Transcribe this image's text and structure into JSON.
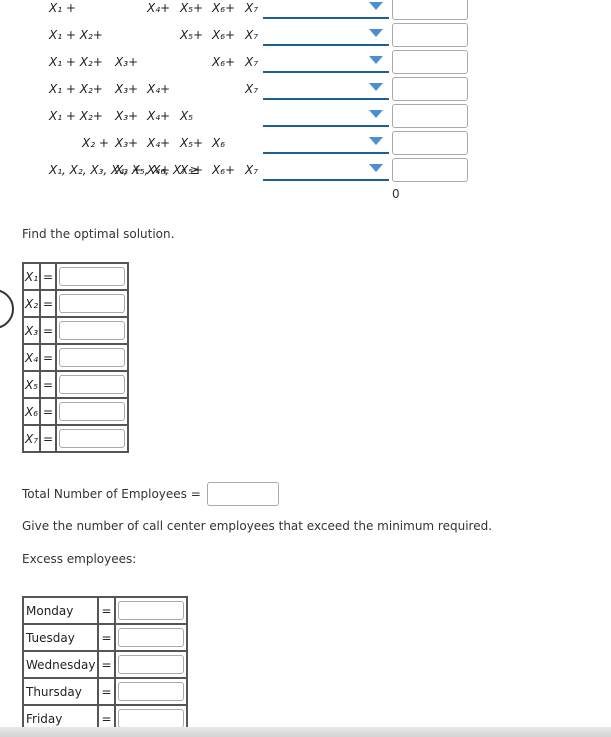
{
  "constraints": [
    {
      "terms": [
        "X₁ +",
        "",
        "",
        "X₄+",
        "X₅+",
        "X₆+",
        "X₇"
      ]
    },
    {
      "terms": [
        "X₁ + X₂+",
        "",
        "",
        "",
        "X₅+",
        "X₆+",
        "X₇"
      ]
    },
    {
      "terms": [
        "X₁ + X₂+",
        "",
        "X₃+",
        "",
        "",
        "X₆+",
        "X₇"
      ]
    },
    {
      "terms": [
        "X₁ + X₂+",
        "",
        "X₃+",
        "X₄+",
        "",
        "",
        "X₇"
      ]
    },
    {
      "terms": [
        "X₁ + X₂+",
        "",
        "X₃+",
        "X₄+",
        "X₅",
        "",
        ""
      ]
    },
    {
      "terms": [
        "",
        "X₂ +",
        "X₃+",
        "X₄+",
        "X₅+",
        "X₆",
        ""
      ]
    },
    {
      "terms": [
        "",
        "",
        "X₃ +",
        "X₄+",
        "X₅+",
        "X₆+",
        "X₇"
      ]
    }
  ],
  "nonneg": {
    "vars": "X₁,  X₂,  X₃,  X₄,  X₅,  X₆,  X₇ ≥",
    "rhs": "0"
  },
  "find_prompt": "Find the optimal solution.",
  "solution_vars": [
    "X₁",
    "X₂",
    "X₃",
    "X₄",
    "X₅",
    "X₆",
    "X₇"
  ],
  "equals": "=",
  "total_label": "Total Number of Employees =",
  "excess_prompt": "Give the number of call center employees that exceed the minimum required.",
  "excess_label": "Excess employees:",
  "days": [
    "Monday",
    "Tuesday",
    "Wednesday",
    "Thursday",
    "Friday"
  ],
  "colors": {
    "dropdown_underline": "#1a5f96",
    "arrow": "#4a8fd0"
  }
}
